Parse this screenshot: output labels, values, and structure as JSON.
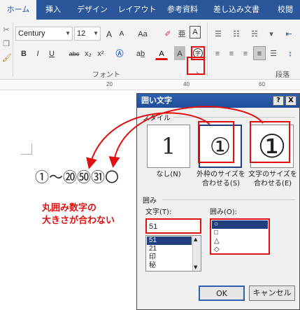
{
  "ribbon": {
    "tabs": [
      "ホーム",
      "挿入",
      "デザイン",
      "レイアウト",
      "参考資料",
      "差し込み文書",
      "校閲"
    ],
    "font_name": "Century",
    "font_size": "12",
    "button_labels": {
      "grow": "A",
      "shrink": "A",
      "case": "Aa",
      "bold": "B",
      "italic": "I",
      "underline": "U",
      "strike": "abc",
      "subscript": "x₂",
      "superscript": "x²",
      "font_color": "A",
      "char_shading": "A",
      "enclose": "字",
      "border": "A"
    },
    "group_font": "フォント",
    "group_paragraph": "段落"
  },
  "ruler": {
    "marks": [
      "20",
      "40",
      "60"
    ]
  },
  "document": {
    "text": "①～⑳㊿㉛〇",
    "note_line1": "丸囲み数字の",
    "note_line2": "大きさが合わない"
  },
  "dialog": {
    "title": "囲い文字",
    "help": "?",
    "close": "X",
    "style_label": "スタイル",
    "options": [
      {
        "sample": "1",
        "label_line1": "なし(N)",
        "label_line2": ""
      },
      {
        "sample": "①",
        "label_line1": "外枠のサイズを",
        "label_line2": "合わせる(S)"
      },
      {
        "sample": "①",
        "label_line1": "文字のサイズを",
        "label_line2": "合わせる(E)"
      }
    ],
    "enclose_section": "囲み",
    "text_label": "文字(T):",
    "text_value": "51",
    "text_list": [
      "51",
      "21",
      "印",
      "秘"
    ],
    "shape_label": "囲み(O):",
    "shapes": [
      "○",
      "□",
      "△",
      "◇"
    ],
    "ok": "OK",
    "cancel": "キャンセル"
  },
  "colors": {
    "ribbon_blue": "#2b579a",
    "annotation_red": "#e01010",
    "selection_navy": "#1f3f7f"
  }
}
